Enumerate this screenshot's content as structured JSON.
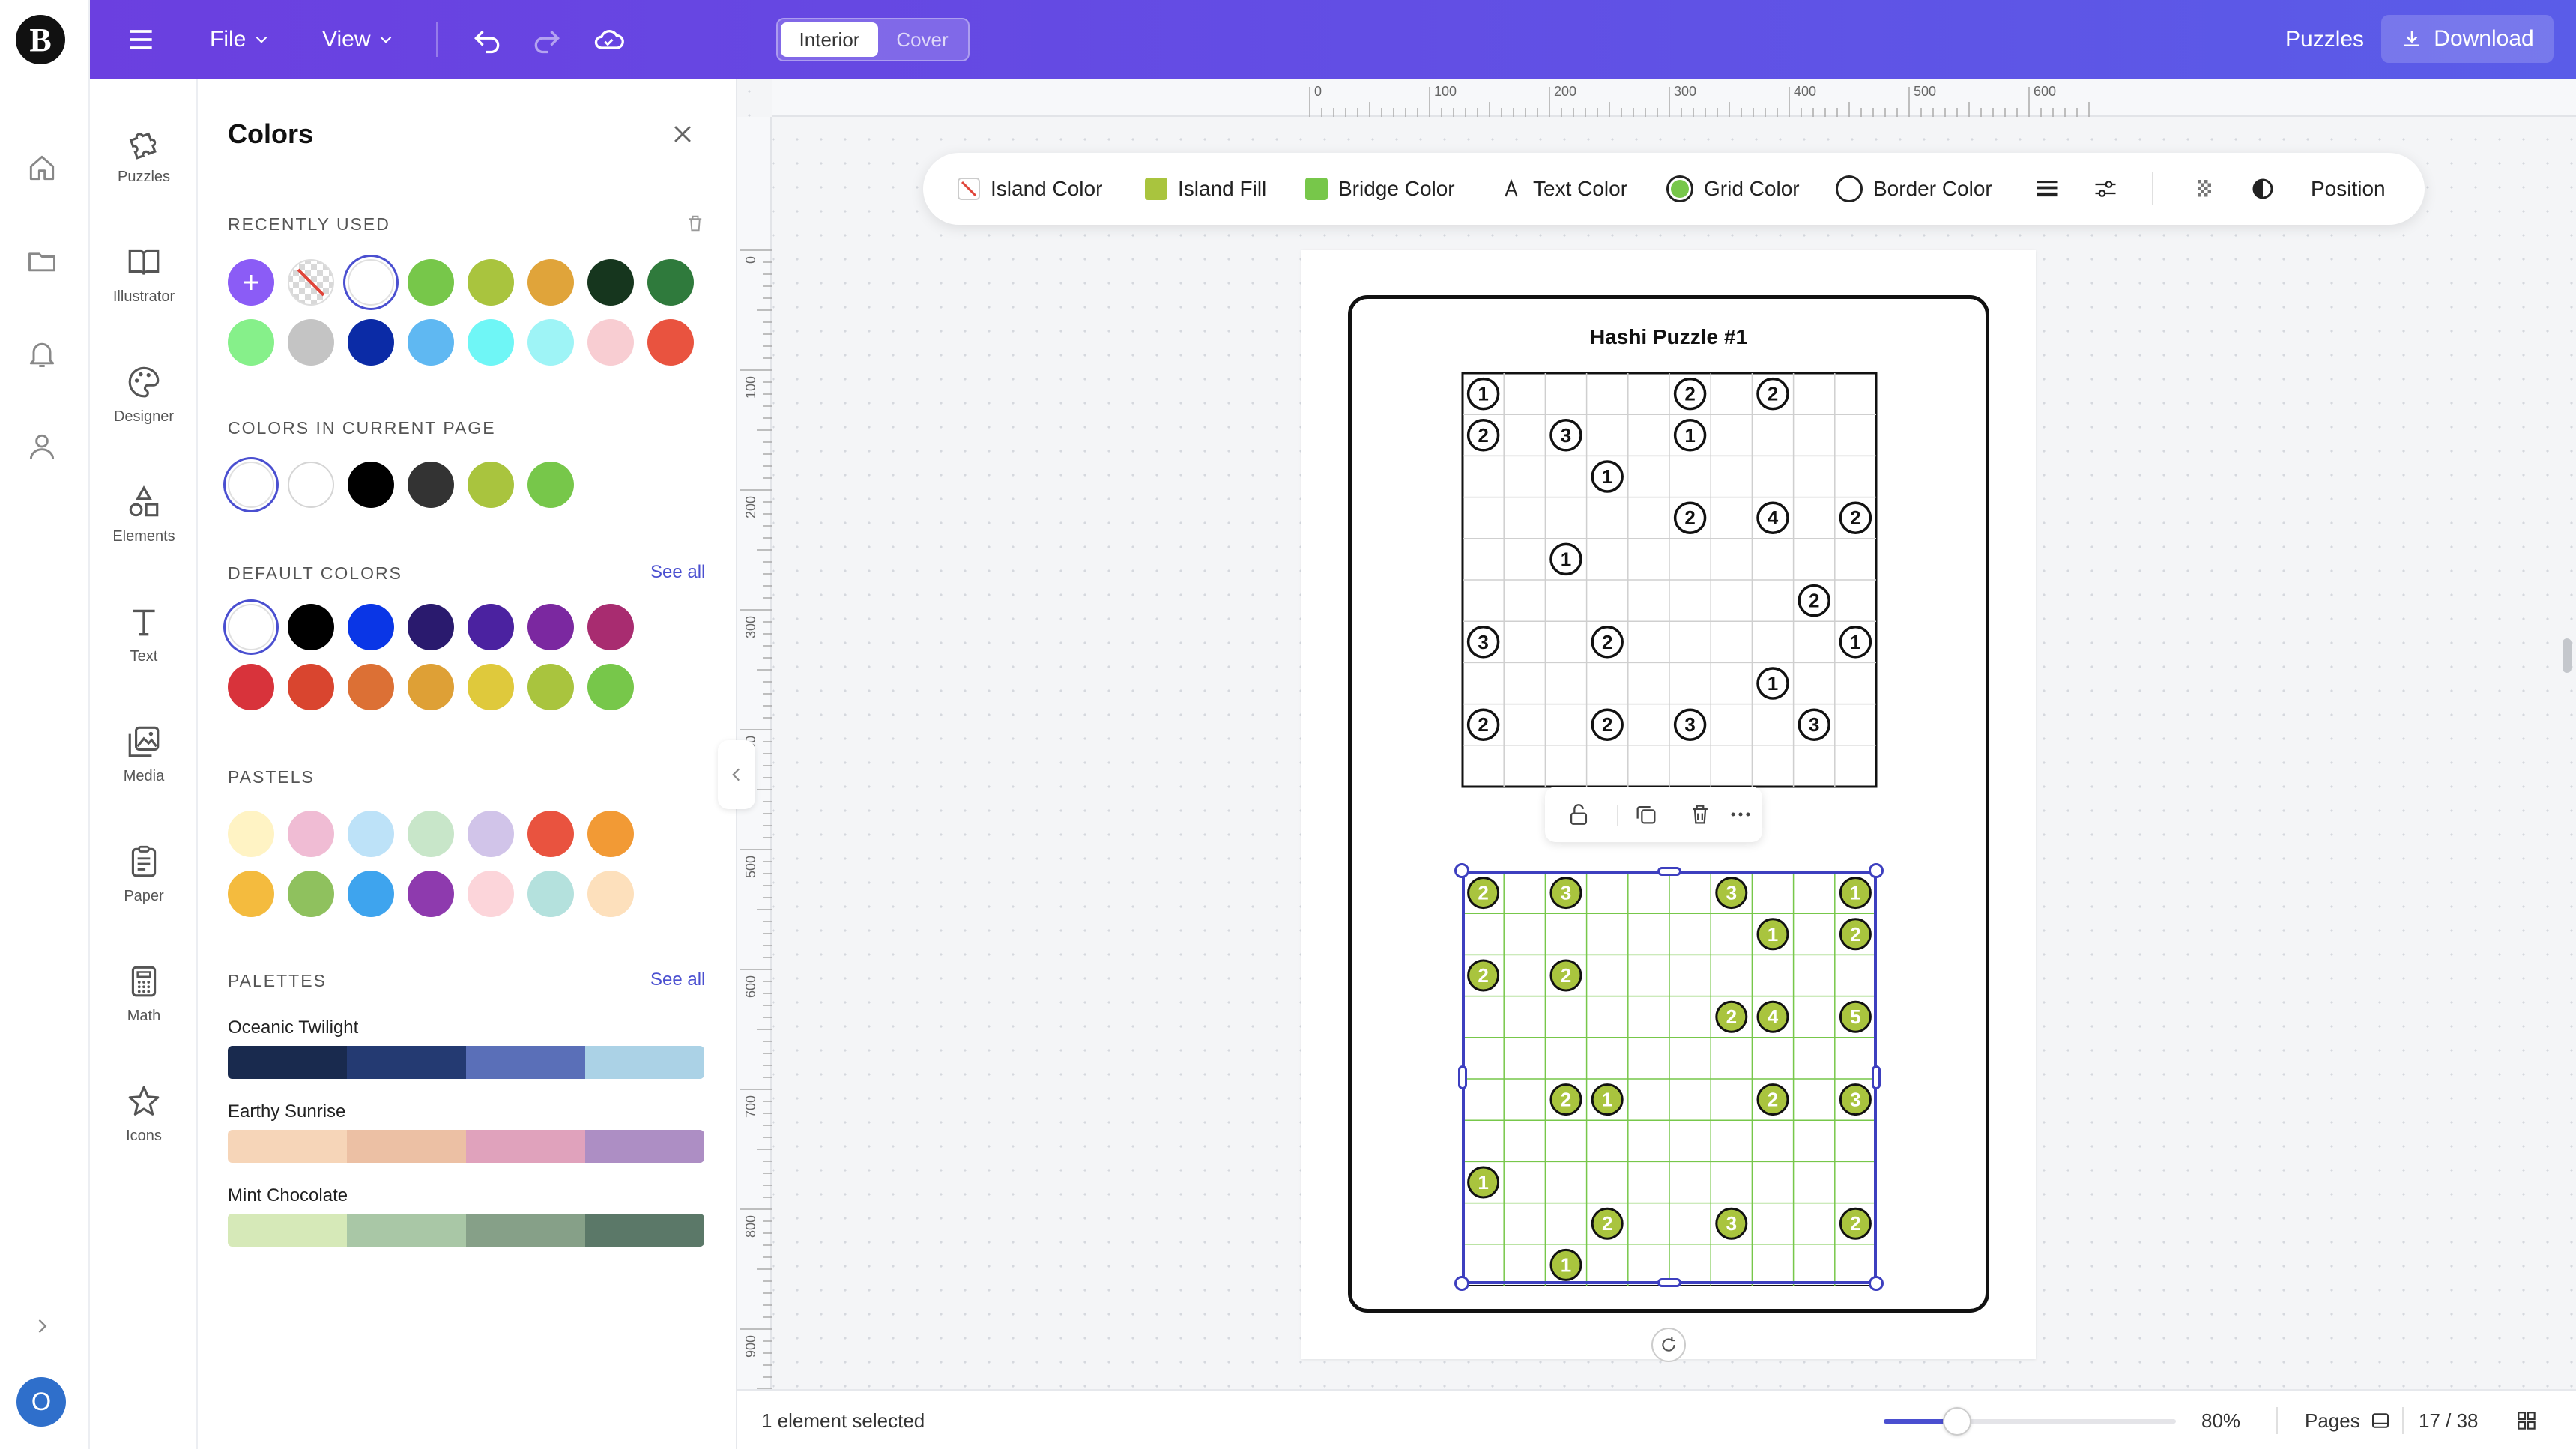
{
  "app": {
    "logo_letter": "B",
    "avatar_letter": "O"
  },
  "topbar": {
    "file_label": "File",
    "view_label": "View",
    "interior_tab": "Interior",
    "cover_tab": "Cover",
    "puzzles_link": "Puzzles",
    "download_label": "Download"
  },
  "tools": [
    {
      "label": "Puzzles",
      "icon": "puzzle-icon"
    },
    {
      "label": "Illustrator",
      "icon": "book-icon"
    },
    {
      "label": "Designer",
      "icon": "palette-icon"
    },
    {
      "label": "Elements",
      "icon": "shapes-icon"
    },
    {
      "label": "Text",
      "icon": "text-icon"
    },
    {
      "label": "Media",
      "icon": "image-icon"
    },
    {
      "label": "Paper",
      "icon": "paper-icon"
    },
    {
      "label": "Math",
      "icon": "calculator-icon"
    },
    {
      "label": "Icons",
      "icon": "star-icon"
    }
  ],
  "panel": {
    "title": "Colors",
    "recently_used": {
      "heading": "RECENTLY USED",
      "colors": [
        "#8b5cf6",
        "transparent",
        "#ffffff",
        "#77c74a",
        "#a9c43e",
        "#e0a43a",
        "#16361e",
        "#2f7a3c",
        "#86f08a",
        "#c4c4c4",
        "#0b2ba6",
        "#5fb8f2",
        "#6ff6f6",
        "#9ef4f6",
        "#f8cdd2",
        "#e9533f"
      ]
    },
    "current_page": {
      "heading": "COLORS IN CURRENT PAGE",
      "colors": [
        "#ffffff",
        "#ffffff",
        "#000000",
        "#333333",
        "#a9c43e",
        "#77c74a"
      ]
    },
    "default_colors": {
      "heading": "DEFAULT COLORS",
      "see_all": "See all",
      "colors": [
        "#ffffff",
        "#000000",
        "#0a36e6",
        "#2a1a6e",
        "#4b22a0",
        "#7b28a0",
        "#a82c70",
        "#d8333b",
        "#d9452f",
        "#dc7035",
        "#dea036",
        "#dfc93c",
        "#a9c43e",
        "#77c74a"
      ]
    },
    "pastels": {
      "heading": "PASTELS",
      "colors": [
        "#fff3c4",
        "#f0bcd4",
        "#bde2f8",
        "#c8e6c9",
        "#d1c4e9",
        "#e9533f",
        "#f29a35",
        "#f4bb3e",
        "#8fc15e",
        "#3ea4ee",
        "#8e3aae",
        "#fcd5da",
        "#b4e1dd",
        "#fde0bc"
      ]
    },
    "palettes": {
      "heading": "PALETTES",
      "see_all": "See all",
      "items": [
        {
          "name": "Oceanic Twilight",
          "colors": [
            "#192a4e",
            "#243a72",
            "#5a6fb8",
            "#abd2e6"
          ]
        },
        {
          "name": "Earthy Sunrise",
          "colors": [
            "#f6d5b8",
            "#ecc0a4",
            "#e0a2bc",
            "#ad8ec4"
          ]
        },
        {
          "name": "Mint Chocolate",
          "colors": [
            "#d6e9b8",
            "#a9c7a6",
            "#86a088",
            "#5b7868"
          ]
        }
      ]
    }
  },
  "rulers": {
    "h_ticks": [
      "0",
      "100",
      "200",
      "300",
      "400",
      "500",
      "600"
    ],
    "v_ticks": [
      "0",
      "100",
      "200",
      "300",
      "400",
      "500",
      "600",
      "700",
      "800",
      "900"
    ]
  },
  "context_toolbar": {
    "island_color": "Island Color",
    "island_fill": "Island Fill",
    "bridge_color": "Bridge Color",
    "text_color": "Text Color",
    "grid_color": "Grid Color",
    "border_color": "Border Color",
    "position": "Position",
    "island_fill_swatch": "#a9c43e",
    "bridge_color_swatch": "#77c74a",
    "grid_color_swatch": "#77c74a"
  },
  "page": {
    "title": "Hashi Puzzle #1",
    "puzzle1": {
      "islands": [
        {
          "r": 0,
          "c": 0,
          "n": "1"
        },
        {
          "r": 0,
          "c": 5,
          "n": "2"
        },
        {
          "r": 0,
          "c": 7,
          "n": "2"
        },
        {
          "r": 1,
          "c": 0,
          "n": "2"
        },
        {
          "r": 1,
          "c": 2,
          "n": "3"
        },
        {
          "r": 1,
          "c": 5,
          "n": "1"
        },
        {
          "r": 2,
          "c": 3,
          "n": "1"
        },
        {
          "r": 3,
          "c": 5,
          "n": "2"
        },
        {
          "r": 3,
          "c": 7,
          "n": "4"
        },
        {
          "r": 3,
          "c": 9,
          "n": "2"
        },
        {
          "r": 4,
          "c": 2,
          "n": "1"
        },
        {
          "r": 5,
          "c": 8,
          "n": "2"
        },
        {
          "r": 6,
          "c": 0,
          "n": "3"
        },
        {
          "r": 6,
          "c": 3,
          "n": "2"
        },
        {
          "r": 6,
          "c": 9,
          "n": "1"
        },
        {
          "r": 7,
          "c": 7,
          "n": "1"
        },
        {
          "r": 8,
          "c": 0,
          "n": "2"
        },
        {
          "r": 8,
          "c": 3,
          "n": "2"
        },
        {
          "r": 8,
          "c": 5,
          "n": "3"
        },
        {
          "r": 8,
          "c": 8,
          "n": "3"
        }
      ]
    },
    "puzzle2": {
      "islands": [
        {
          "r": 0,
          "c": 0,
          "n": "2"
        },
        {
          "r": 0,
          "c": 2,
          "n": "3"
        },
        {
          "r": 0,
          "c": 6,
          "n": "3"
        },
        {
          "r": 0,
          "c": 9,
          "n": "1"
        },
        {
          "r": 1,
          "c": 7,
          "n": "1"
        },
        {
          "r": 1,
          "c": 9,
          "n": "2"
        },
        {
          "r": 2,
          "c": 0,
          "n": "2"
        },
        {
          "r": 2,
          "c": 2,
          "n": "2"
        },
        {
          "r": 3,
          "c": 6,
          "n": "2"
        },
        {
          "r": 3,
          "c": 7,
          "n": "4"
        },
        {
          "r": 3,
          "c": 9,
          "n": "5"
        },
        {
          "r": 5,
          "c": 2,
          "n": "2"
        },
        {
          "r": 5,
          "c": 3,
          "n": "1"
        },
        {
          "r": 5,
          "c": 7,
          "n": "2"
        },
        {
          "r": 5,
          "c": 9,
          "n": "3"
        },
        {
          "r": 7,
          "c": 0,
          "n": "1"
        },
        {
          "r": 8,
          "c": 3,
          "n": "2"
        },
        {
          "r": 8,
          "c": 6,
          "n": "3"
        },
        {
          "r": 8,
          "c": 9,
          "n": "2"
        },
        {
          "r": 9,
          "c": 2,
          "n": "1"
        }
      ]
    }
  },
  "status": {
    "selection": "1 element selected",
    "zoom": "80%",
    "zoom_level": 0.25,
    "pages_label": "Pages",
    "page_counter": "17 / 38"
  }
}
